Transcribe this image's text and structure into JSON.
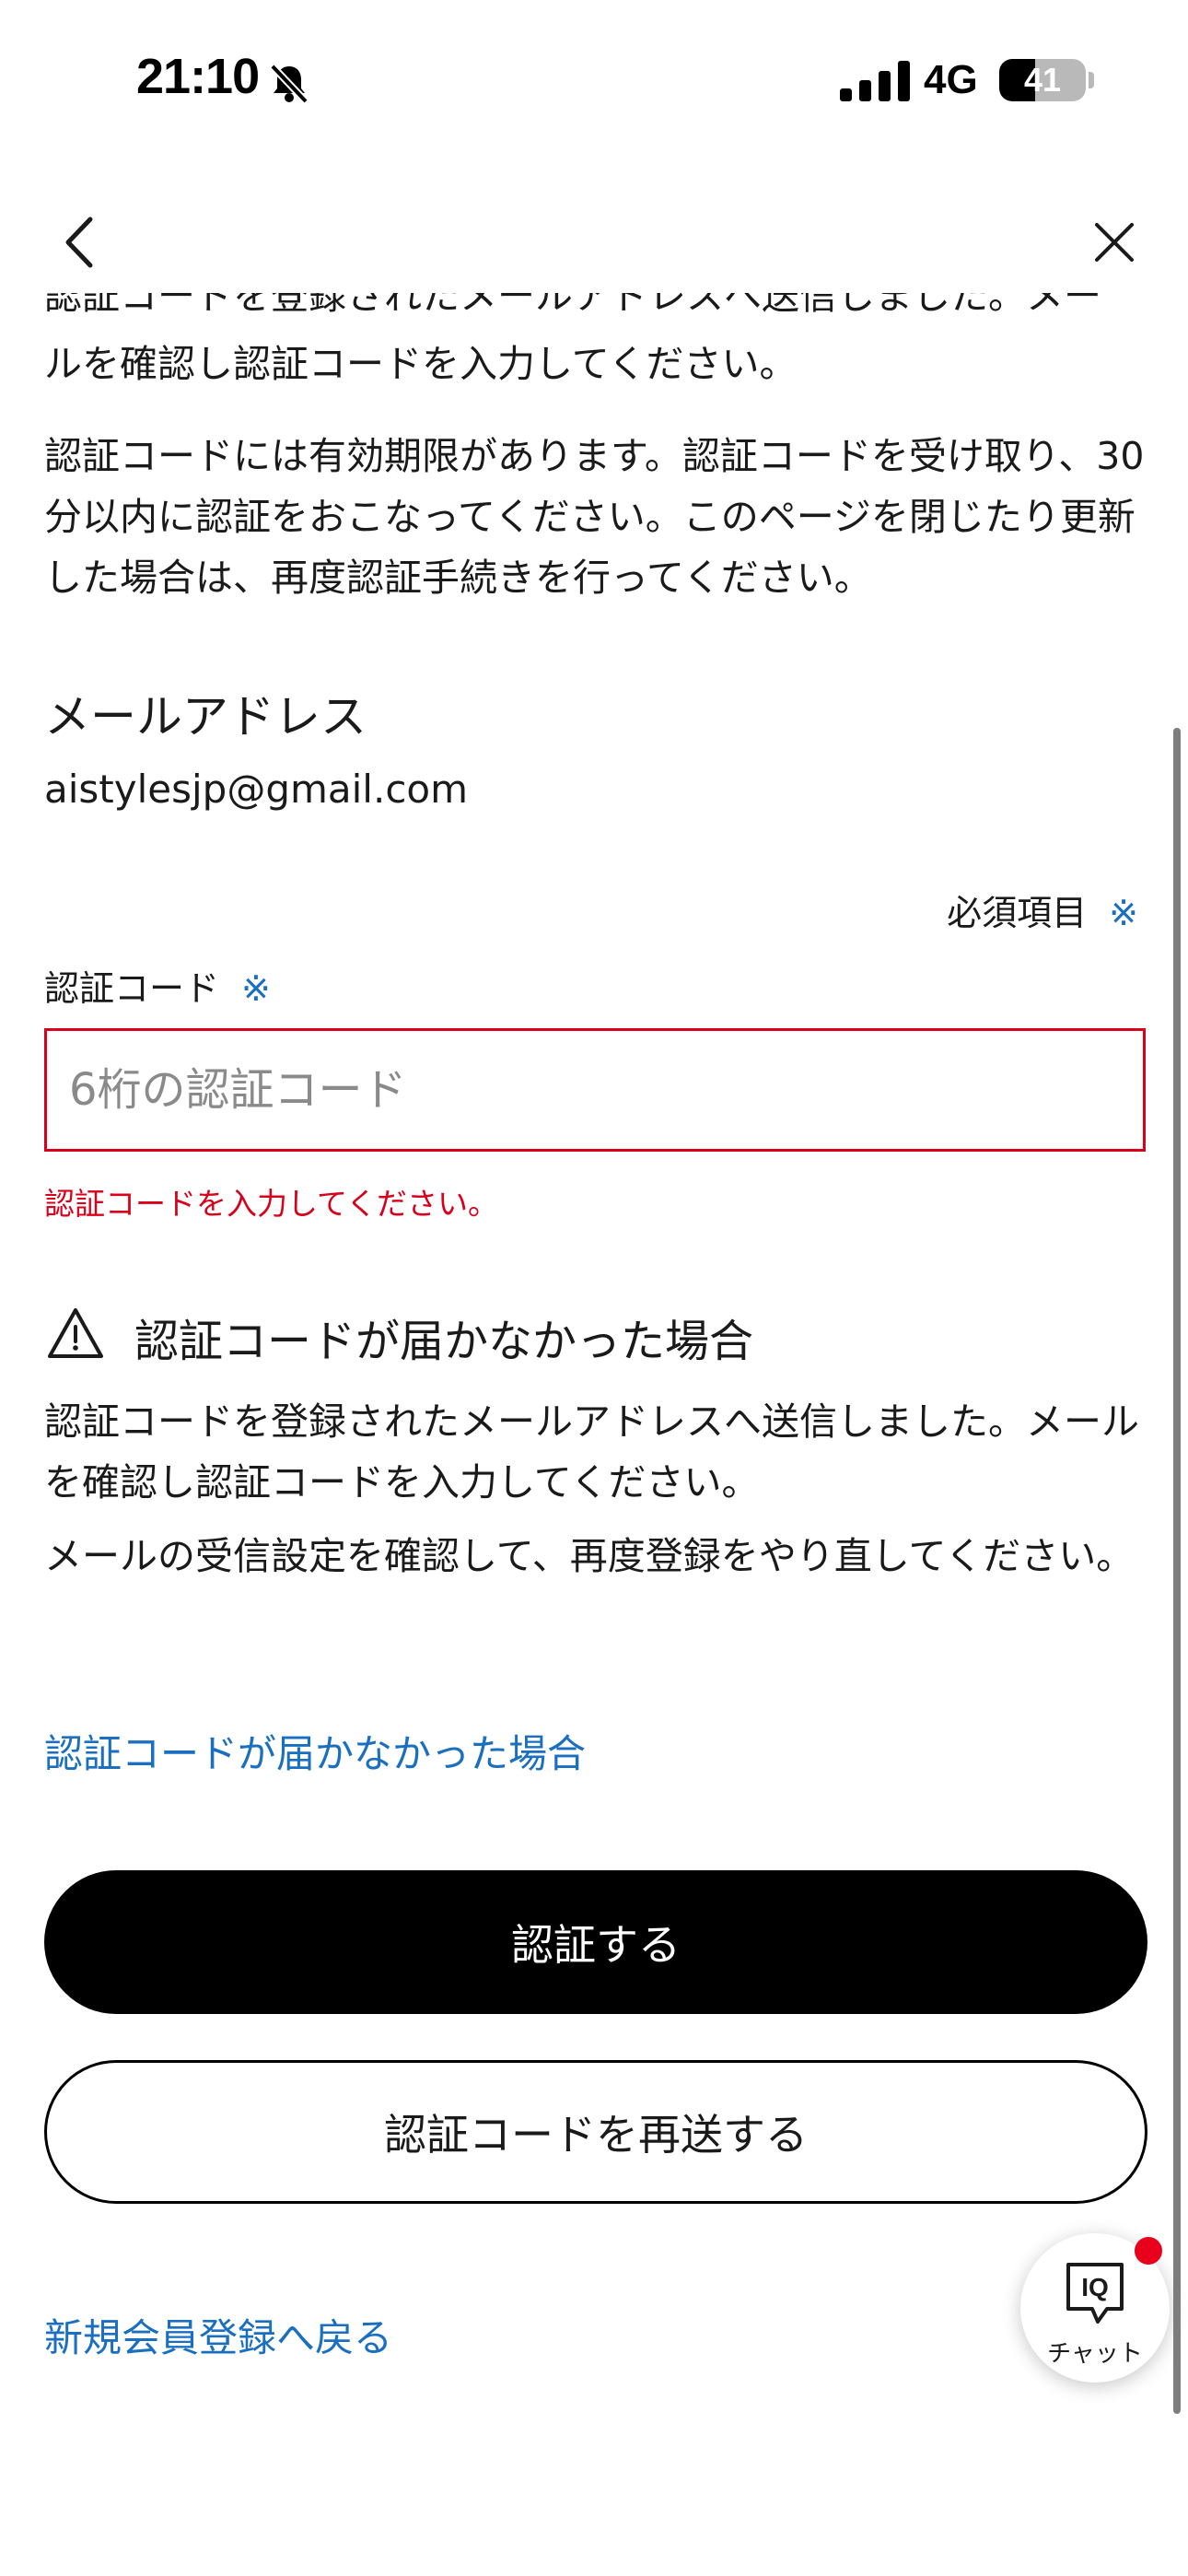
{
  "status_bar": {
    "time": "21:10",
    "network": "4G",
    "battery": "41",
    "battery_level": 0.41
  },
  "content": {
    "intro_cut": "認証コードを登録されたメールアドレスへ送信しました。メー",
    "intro_p2": "ルを確認し認証コードを入力してください。",
    "validity": "認証コードには有効期限があります。認証コードを受け取り、30分以内に認証をおこなってください。このページを閉じたり更新した場合は、再度認証手続きを行ってください。",
    "email_heading": "メールアドレス",
    "email_value": "aistylesjp@gmail.com",
    "required_note": "必須項目",
    "required_mark": "※",
    "code_label": "認証コード",
    "code_placeholder": "6桁の認証コード",
    "code_value": "",
    "code_error": "認証コードを入力してください。",
    "trouble_title": "認証コードが届かなかった場合",
    "trouble_p1": "認証コードを登録されたメールアドレスへ送信しました。メールを確認し認証コードを入力してください。",
    "trouble_p2": "メールの受信設定を確認して、再度登録をやり直してください。",
    "trouble_link": "認証コードが届かなかった場合",
    "verify_button": "認証する",
    "resend_button": "認証コードを再送する",
    "back_link": "新規会員登録へ戻る"
  },
  "chat": {
    "label": "チャット",
    "icon_text": "IQ"
  },
  "icons": {
    "back": "chevron-left-icon",
    "close": "close-icon",
    "warning": "warning-triangle-icon",
    "chat": "chat-bubble-icon",
    "silent": "bell-slash-icon"
  },
  "colors": {
    "link": "#1a6fc0",
    "error": "#d8001a",
    "primary_button": "#000000",
    "notification_dot": "#e8001c"
  }
}
